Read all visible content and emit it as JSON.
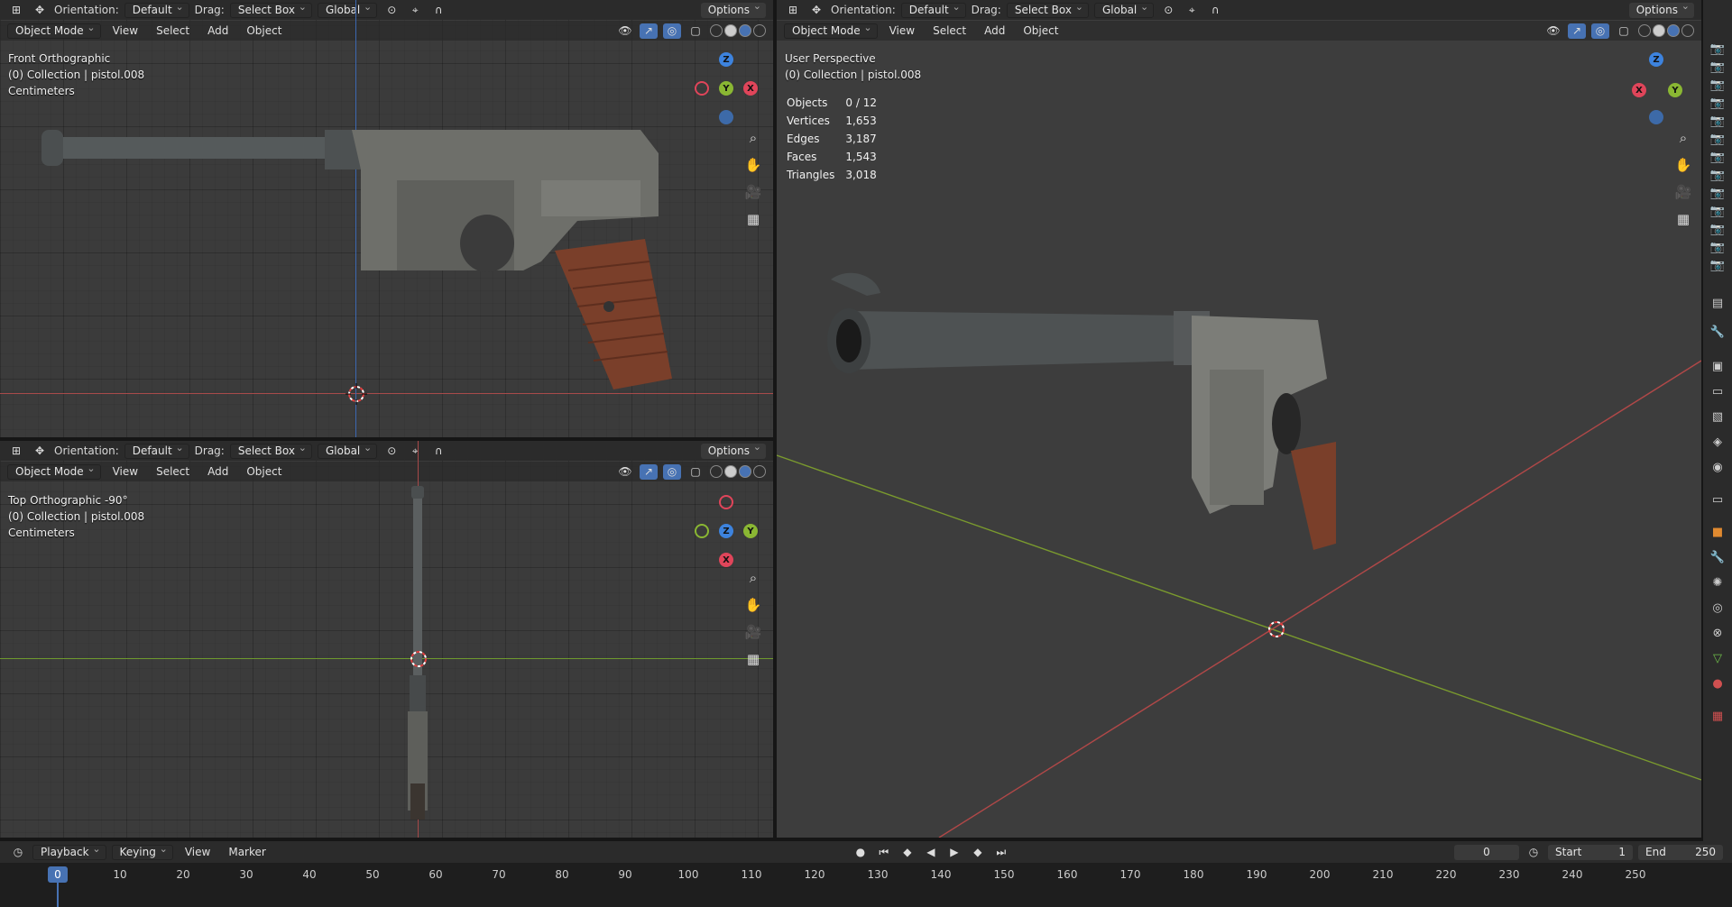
{
  "header": {
    "orientation_label": "Orientation:",
    "orientation_value": "Default",
    "drag_label": "Drag:",
    "drag_value": "Select Box",
    "transform_value": "Global",
    "options_label": "Options"
  },
  "menu": {
    "mode": "Object Mode",
    "view": "View",
    "select": "Select",
    "add": "Add",
    "object": "Object"
  },
  "viewports": {
    "front": {
      "title": "Front Orthographic",
      "collection": "(0) Collection | pistol.008",
      "units": "Centimeters"
    },
    "top": {
      "title": "Top Orthographic -90°",
      "collection": "(0) Collection | pistol.008",
      "units": "Centimeters"
    },
    "persp": {
      "title": "User Perspective",
      "collection": "(0) Collection | pistol.008"
    }
  },
  "stats": {
    "objects_label": "Objects",
    "objects": "0 / 12",
    "vertices_label": "Vertices",
    "vertices": "1,653",
    "edges_label": "Edges",
    "edges": "3,187",
    "faces_label": "Faces",
    "faces": "1,543",
    "triangles_label": "Triangles",
    "triangles": "3,018"
  },
  "gizmo": {
    "x": "X",
    "y": "Y",
    "z": "Z"
  },
  "colors": {
    "x_axis": "#e0455a",
    "y_axis": "#8ab733",
    "z_axis": "#3d83de",
    "accent": "#4772b3"
  },
  "timeline": {
    "playback": "Playback",
    "keying": "Keying",
    "view": "View",
    "marker": "Marker",
    "current_frame": "0",
    "start_label": "Start",
    "start": "1",
    "end_label": "End",
    "end": "250",
    "ruler_current": "0",
    "ticks": [
      "10",
      "20",
      "30",
      "40",
      "50",
      "60",
      "70",
      "80",
      "90",
      "100",
      "110",
      "120",
      "130",
      "140",
      "150",
      "160",
      "170",
      "180",
      "190",
      "200",
      "210",
      "220",
      "230",
      "240",
      "250"
    ]
  }
}
